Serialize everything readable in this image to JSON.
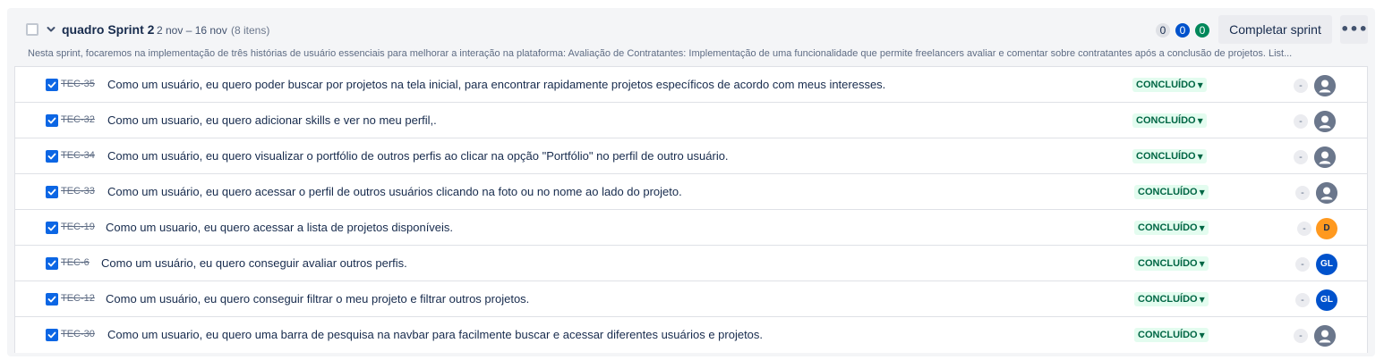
{
  "sprint": {
    "name": "quadro Sprint 2",
    "dates": "2 nov – 16 nov",
    "count": "(8 itens)",
    "description": "Nesta sprint, focaremos na implementação de três histórias de usuário essenciais para melhorar a interação na plataforma: Avaliação de Contratantes: Implementação de uma funcionalidade que permite freelancers avaliar e comentar sobre contratantes após a conclusão de projetos. List...",
    "counters": {
      "todo": "0",
      "in_progress": "0",
      "done": "0"
    },
    "complete_label": "Completar sprint",
    "more_label": "•••"
  },
  "issues": [
    {
      "key": "TEC-35",
      "summary": "Como um usuário, eu quero poder buscar por projetos na tela inicial, para encontrar rapidamente projetos específicos de acordo com meus interesses.",
      "status": "CONCLUÍDO",
      "estimate": "-",
      "assignee": ""
    },
    {
      "key": "TEC-32",
      "summary": "Como um usuario, eu quero adicionar skills e ver no meu perfil,.",
      "status": "CONCLUÍDO",
      "estimate": "-",
      "assignee": ""
    },
    {
      "key": "TEC-34",
      "summary": "Como um usuário, eu quero visualizar o portfólio de outros perfis ao clicar na opção \"Portfólio\" no perfil de outro usuário.",
      "status": "CONCLUÍDO",
      "estimate": "-",
      "assignee": ""
    },
    {
      "key": "TEC-33",
      "summary": "Como um usuário, eu quero acessar o perfil de outros usuários clicando na foto ou no nome ao lado do projeto.",
      "status": "CONCLUÍDO",
      "estimate": "-",
      "assignee": ""
    },
    {
      "key": "TEC-19",
      "summary": "Como um usuario, eu quero acessar a lista de projetos disponíveis.",
      "status": "CONCLUÍDO",
      "estimate": "-",
      "assignee": "D"
    },
    {
      "key": "TEC-6",
      "summary": "Como um usuário, eu quero conseguir avaliar outros perfis.",
      "status": "CONCLUÍDO",
      "estimate": "-",
      "assignee": "GL"
    },
    {
      "key": "TEC-12",
      "summary": "Como um usuário, eu quero conseguir filtrar o meu projeto e filtrar outros projetos.",
      "status": "CONCLUÍDO",
      "estimate": "-",
      "assignee": "GL"
    },
    {
      "key": "TEC-30",
      "summary": "Como um usuario, eu quero uma barra de pesquisa na navbar para facilmente buscar e acessar diferentes usuários e projetos.",
      "status": "CONCLUÍDO",
      "estimate": "-",
      "assignee": ""
    }
  ],
  "colors": {
    "status_bg": "#e3fcef",
    "status_text": "#006644",
    "counter_blue": "#0052cc",
    "counter_green": "#00875a",
    "avatar_d": "#ff991f",
    "avatar_gl": "#0052cc"
  },
  "icons": {
    "chevron": "chevron-down-icon",
    "row_check": "checkbox-checked-icon",
    "default_avatar": "person-icon"
  }
}
